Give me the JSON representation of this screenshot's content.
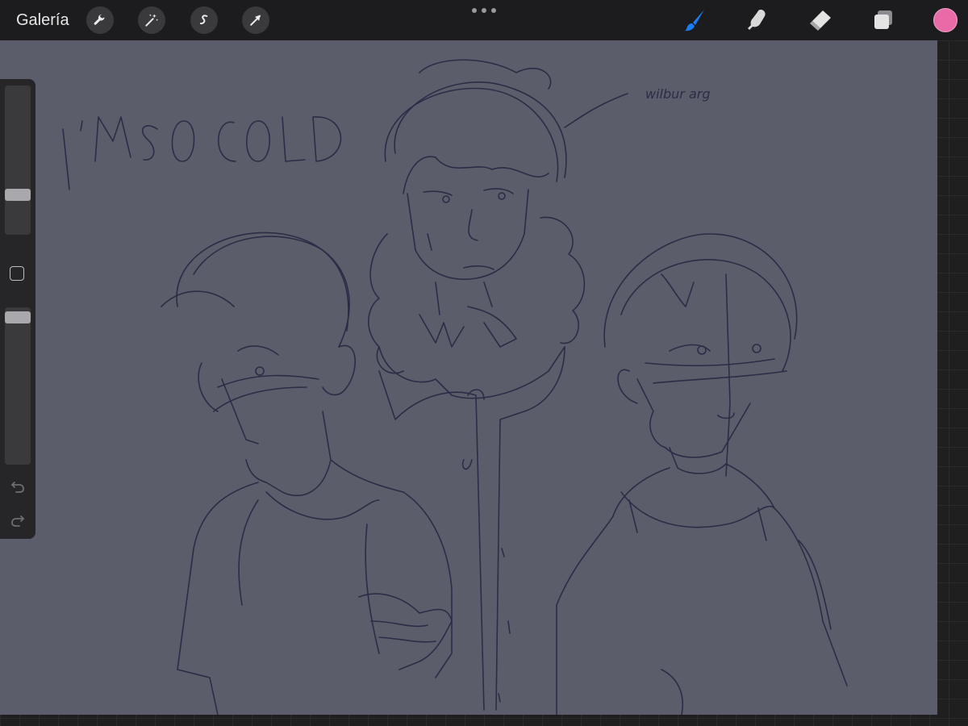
{
  "topbar": {
    "gallery_label": "Galería",
    "left_tools": [
      {
        "name": "actions",
        "icon": "wrench-icon"
      },
      {
        "name": "adjustments",
        "icon": "magic-wand-icon"
      },
      {
        "name": "selection",
        "icon": "selection-s-icon"
      },
      {
        "name": "transform",
        "icon": "arrow-cursor-icon"
      }
    ],
    "right_tools": [
      {
        "name": "brush",
        "icon": "brush-icon",
        "active": true,
        "color": "#1c7cf4"
      },
      {
        "name": "smudge",
        "icon": "smudge-finger-icon"
      },
      {
        "name": "eraser",
        "icon": "eraser-icon"
      },
      {
        "name": "layers",
        "icon": "layers-icon"
      }
    ],
    "current_color": "#e86aa6"
  },
  "sidebar": {
    "brush_size_level": 0.25,
    "opacity_level": 0.97,
    "undo_icon": "undo-arrow-icon",
    "redo_icon": "redo-arrow-icon"
  },
  "canvas": {
    "background_color": "#5c5d6b",
    "stroke_color": "#2d2c46",
    "texts": {
      "title_doodle": "I'M SO COLD",
      "annotation": "wilbur arg"
    }
  }
}
